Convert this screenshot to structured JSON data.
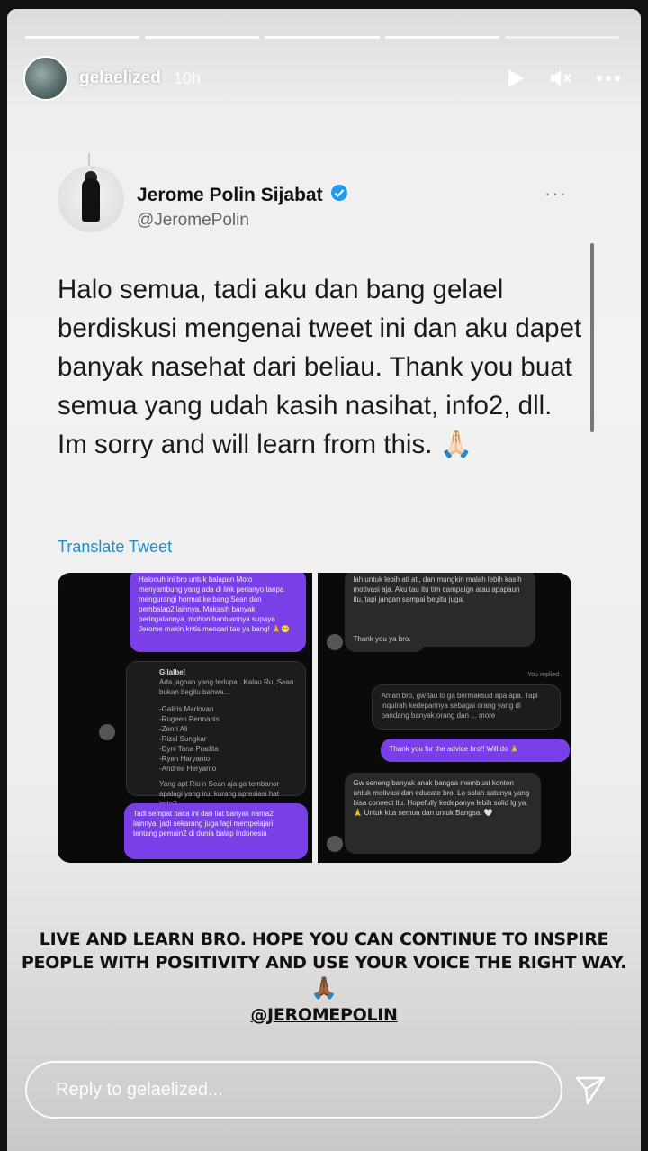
{
  "story": {
    "username": "gelaelized",
    "time": "10h",
    "segments_total": 5,
    "segments_done": 4
  },
  "tweet": {
    "name": "Jerome Polin Sijabat",
    "handle": "@JeromePolin",
    "more": "···",
    "text": "Halo semua, tadi aku dan bang gelael berdiskusi mengenai tweet ini dan aku dapet banyak nasehat dari beliau. Thank you buat semua yang udah kasih nasihat, info2, dll. Im sorry and will learn from this. 🙏🏻",
    "translate": "Translate Tweet",
    "media": {
      "left": {
        "bubble1": "Haloouh ini bro untuk balapan Moto menyambung yang ada di link perlanyo tanpa mengurangi hormat ke bang Sean dan pembalap2 lainnya. Makasih banyak peringatannya, mohon bantuannya supaya Jerome makin kritis mencari tau ya bang! 🙏😁",
        "quote_user": "Gilalbel",
        "quote_text": "Ada jagoan yang terlupa.. Kalau Ru, Sean bukan begitu bahwa...",
        "quote_list": "-Galiris Marlovan\n-Rugeen Permanis\n-Zenri Ali\n-Rizal Sungkar\n-Dyni Tana Pradita\n-Ryan Haryanto\n-Andrea Heryanto",
        "quote_footer": "Yang apt Rio n Sean aja ga tembanor apalagi yang iru, kurang apresiasi hat imta?",
        "bubble2": "Tadi sempat baca ini dan liat banyak nama2 lainnya, jadi sekarang juga lagi mempelajari tentang pemain2 di dunia balap Indonesia"
      },
      "right": {
        "bubble1": "lah untuk lebih ati ati, dan mungkin malah lebih kasih motivasi aja. Aku tau itu tim campaign atau apapaun itu, tapi jangan sampai begitu juga.",
        "bubble2": "Thank you ya bro.",
        "replied": "You replied",
        "bubble3": "Aman bro, gw tau lo ga bermaksud apa apa. Tapi inquirah kedepannya sebagai orang yang di pandang banyak orang dan ... more",
        "bubble4": "Thank you for the advice bro!! Will do 🙏",
        "bubble5": "Gw seneng banyak anak bangsa membuat konten untuk motivasi dan educate bro. Lo salah satunya yang bisa connect itu. Hopefully kedepanya lebih solid lg ya. 🙏 Untuk kita semua dan untuk Bangsa. 🤍"
      }
    }
  },
  "caption": {
    "line1": "LIVE AND LEARN BRO. HOPE YOU CAN CONTINUE TO INSPIRE",
    "line2": "PEOPLE WITH POSITIVITY AND USE YOUR VOICE THE RIGHT WAY.",
    "emoji": "🙏🏾",
    "mention": "@JEROMEPOLIN"
  },
  "reply": {
    "placeholder": "Reply to gelaelized..."
  },
  "icons": [
    "play-icon",
    "mute-icon",
    "more-icon",
    "verified-badge-icon",
    "send-icon"
  ]
}
